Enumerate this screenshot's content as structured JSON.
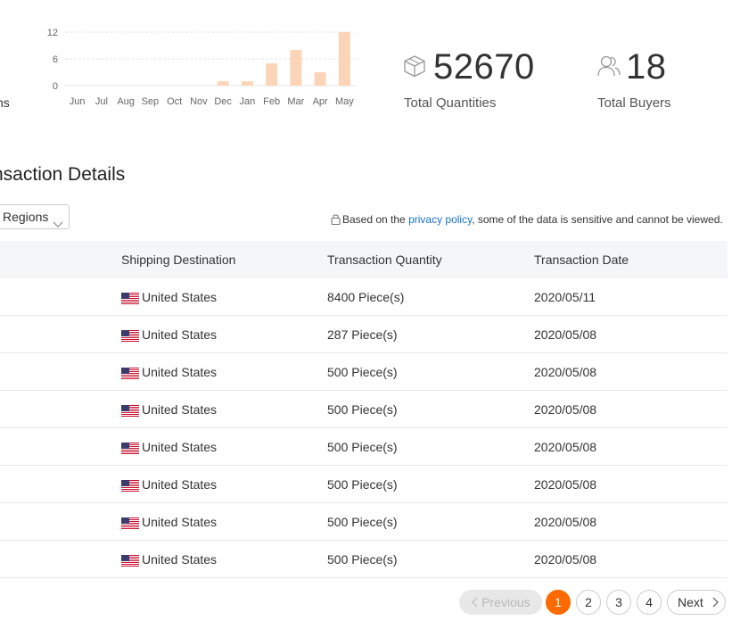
{
  "chart_data": {
    "type": "bar",
    "categories": [
      "Jun",
      "Jul",
      "Aug",
      "Sep",
      "Oct",
      "Nov",
      "Dec",
      "Jan",
      "Feb",
      "Mar",
      "Apr",
      "May"
    ],
    "values": [
      0,
      0,
      0,
      0,
      0,
      0,
      1,
      1,
      5,
      8,
      3,
      12
    ],
    "yticks": [
      "12",
      "6",
      "0"
    ],
    "ylim": [
      0,
      12
    ],
    "bar_color": "#fcd5b8",
    "grid": true
  },
  "partial_label": "ns",
  "stats": {
    "quantity_value": "52670",
    "quantity_label": "Total Quantities",
    "buyers_value": "18",
    "buyers_label": "Total Buyers"
  },
  "section_title": "nsaction Details",
  "filter": {
    "regions_label": "Regions"
  },
  "privacy": {
    "prefix": "Based on the ",
    "link": "privacy policy",
    "suffix": ", some of the data is sensitive and cannot be viewed."
  },
  "table": {
    "headers": {
      "destination": "Shipping Destination",
      "quantity": "Transaction Quantity",
      "date": "Transaction Date"
    },
    "rows": [
      {
        "destination": "United States",
        "quantity": "8400 Piece(s)",
        "date": "2020/05/11"
      },
      {
        "destination": "United States",
        "quantity": "287 Piece(s)",
        "date": "2020/05/08"
      },
      {
        "destination": "United States",
        "quantity": "500 Piece(s)",
        "date": "2020/05/08"
      },
      {
        "destination": "United States",
        "quantity": "500 Piece(s)",
        "date": "2020/05/08"
      },
      {
        "destination": "United States",
        "quantity": "500 Piece(s)",
        "date": "2020/05/08"
      },
      {
        "destination": "United States",
        "quantity": "500 Piece(s)",
        "date": "2020/05/08"
      },
      {
        "destination": "United States",
        "quantity": "500 Piece(s)",
        "date": "2020/05/08"
      },
      {
        "destination": "United States",
        "quantity": "500 Piece(s)",
        "date": "2020/05/08"
      }
    ]
  },
  "pagination": {
    "previous": "Previous",
    "pages": [
      "1",
      "2",
      "3",
      "4"
    ],
    "current": "1",
    "next": "Next",
    "accent": "#ff6a00"
  }
}
